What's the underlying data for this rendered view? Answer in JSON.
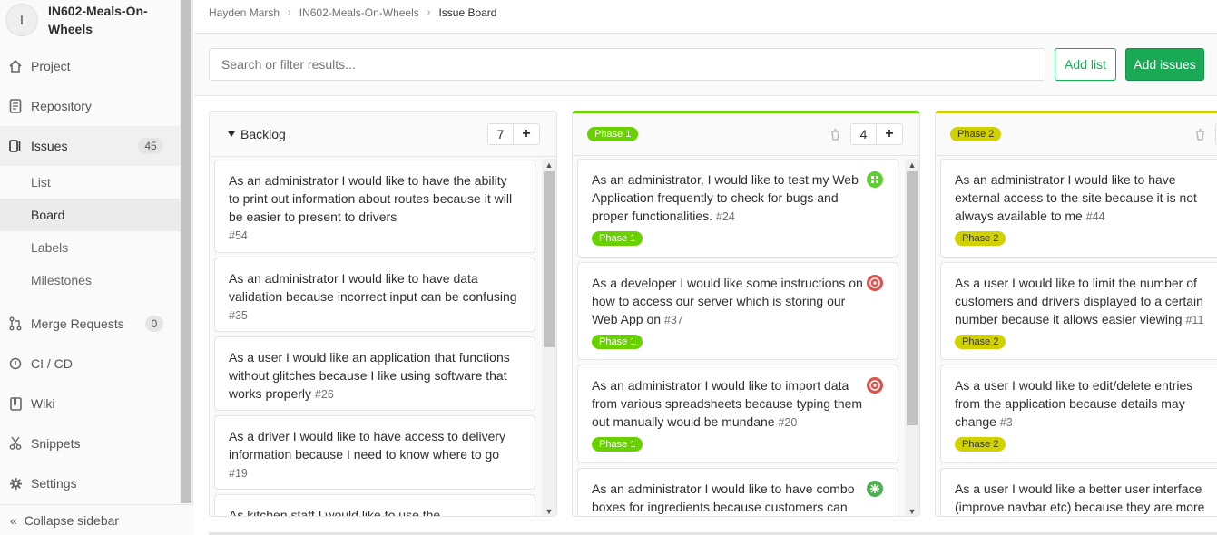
{
  "sidebar": {
    "project_initial": "I",
    "project_name": "IN602-Meals-On-Wheels",
    "nav": [
      {
        "label": "Project",
        "icon": "home-icon"
      },
      {
        "label": "Repository",
        "icon": "document-icon"
      },
      {
        "label": "Issues",
        "icon": "issues-icon",
        "badge": "45"
      },
      {
        "label": "Merge Requests",
        "icon": "merge-request-icon",
        "badge": "0"
      },
      {
        "label": "CI / CD",
        "icon": "rocket-icon"
      },
      {
        "label": "Wiki",
        "icon": "book-icon"
      },
      {
        "label": "Snippets",
        "icon": "scissors-icon"
      },
      {
        "label": "Settings",
        "icon": "gear-icon"
      }
    ],
    "issues_sub": [
      "List",
      "Board",
      "Labels",
      "Milestones"
    ],
    "collapse_label": "Collapse sidebar"
  },
  "breadcrumb": [
    "Hayden Marsh",
    "IN602-Meals-On-Wheels",
    "Issue Board"
  ],
  "filter": {
    "placeholder": "Search or filter results...",
    "add_list": "Add list",
    "add_issues": "Add issues"
  },
  "lists": [
    {
      "title": "Backlog",
      "count": "7",
      "cards": [
        {
          "text": "As an administrator I would like to have the ability to print out information about routes because it will be easier to present to drivers",
          "num": "#54"
        },
        {
          "text": "As an administrator I would like to have data validation because incorrect input can be confusing",
          "num": "#35"
        },
        {
          "text": "As a user I would like an application that functions without glitches because I like using software that works properly",
          "num": "#26"
        },
        {
          "text": "As a driver I would like to have access to delivery information because I need to know where to go",
          "num": "#19"
        },
        {
          "text": "As kitchen staff I would like to use the",
          "num": ""
        }
      ]
    },
    {
      "title": "Phase 1",
      "count": "4",
      "cards": [
        {
          "text": "As an administrator, I would like to test my Web Application frequently to check for bugs and proper functionalities.",
          "num": "#24",
          "label": "Phase 1"
        },
        {
          "text": "As a developer I would like some instructions on how to access our server which is storing our Web App on",
          "num": "#37",
          "label": "Phase 1"
        },
        {
          "text": "As an administrator I would like to import data from various spreadsheets because typing them out manually would be mundane",
          "num": "#20",
          "label": "Phase 1"
        },
        {
          "text": "As an administrator I would like to have combo boxes for ingredients because customers can",
          "num": ""
        }
      ]
    },
    {
      "title": "Phase 2",
      "cards": [
        {
          "text": "As an administrator I would like to have external access to the site because it is not always available to me",
          "num": "#44",
          "label": "Phase 2"
        },
        {
          "text": "As a user I would like to limit the number of customers and drivers displayed to a certain number because it allows easier viewing",
          "num": "#11",
          "label": "Phase 2"
        },
        {
          "text": "As a user I would like to edit/delete entries from the application because details may change",
          "num": "#3",
          "label": "Phase 2"
        },
        {
          "text": "As a user I would like a better user interface (improve navbar etc) because they are more",
          "num": ""
        }
      ]
    }
  ],
  "colors": {
    "phase1": "#69d100",
    "phase2": "#d1d100",
    "green": "#1aaa55"
  }
}
